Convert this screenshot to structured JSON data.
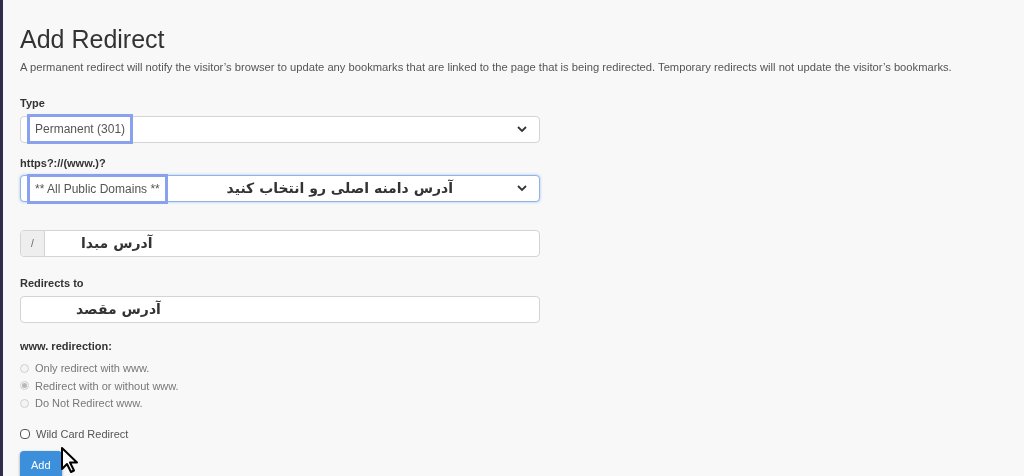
{
  "title": "Add Redirect",
  "description": "A permanent redirect will notify the visitor’s browser to update any bookmarks that are linked to the page that is being redirected. Temporary redirects will not update the visitor’s bookmarks.",
  "type_field": {
    "label": "Type",
    "value": "Permanent (301)",
    "highlighted": true
  },
  "domain_field": {
    "label": "https?://(www.)?",
    "value": "** All Public Domains **",
    "highlighted": true,
    "note": "آدرس دامنه اصلی رو انتخاب کنید"
  },
  "path_field": {
    "prefix": "/",
    "note": "آدرس مبدا"
  },
  "target_field": {
    "label": "Redirects to",
    "note": "آدرس مقصد"
  },
  "www_redirection": {
    "label": "www. redirection:",
    "options": [
      {
        "label": "Only redirect with www.",
        "selected": false
      },
      {
        "label": "Redirect with or without www.",
        "selected": true
      },
      {
        "label": "Do Not Redirect www.",
        "selected": false
      }
    ]
  },
  "wildcard": {
    "label": "Wild Card Redirect",
    "checked": false
  },
  "add_button": "Add"
}
